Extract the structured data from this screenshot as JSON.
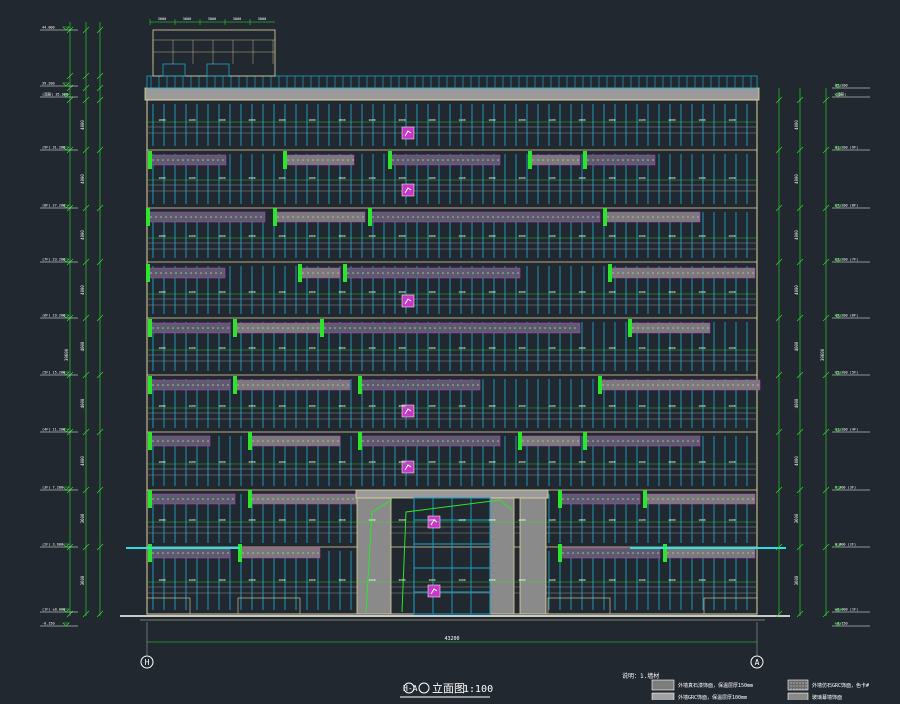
{
  "drawing": {
    "title_prefix": "H-A",
    "title_main": "立面图",
    "title_scale": "1:100",
    "grid_left": "H",
    "grid_right": "A",
    "overall_width": "43200",
    "overall_height_left": "39600",
    "overall_height_right": "39600",
    "notes_title": "说明：1.墙材",
    "legend": [
      "外墙真石漆饰面，保温层厚150mm",
      "外墙GRC饰面，保温层厚100mm",
      "外墙仿石GRC饰面，色卡#",
      "玻璃幕墙饰面"
    ],
    "colors": {
      "background": "#212830",
      "dimension": "#2ce62c",
      "mullion": "#1aa3c8",
      "parapet": "#9a9a9a",
      "outline": "#e3d6a0",
      "accent": "#c838c8",
      "glass": "#3a8cff"
    }
  },
  "elevations": {
    "left": [
      "44.000",
      "39.200",
      "(顶层) 35.200",
      "(9F) 31.200",
      "(8F) 27.200",
      "(7F) 23.200",
      "(6F) 19.200",
      "(5F) 15.200",
      "(4F) 11.200",
      "(3F) 7.200",
      "(2F) 3.600",
      "(1F) ±0.000",
      "-0.150"
    ],
    "right": [
      "35.200",
      "(顶层)",
      "31.200 (9F)",
      "27.200 (8F)",
      "23.200 (7F)",
      "19.200 (6F)",
      "15.200 (5F)",
      "11.200 (4F)",
      "7.200 (3F)",
      "3.600 (2F)",
      "±0.000 (1F)",
      "-0.150"
    ]
  },
  "dims": {
    "top_segments": [
      "3000",
      "3000",
      "3000",
      "3000",
      "3000"
    ],
    "row_segments": [
      "1800",
      "1600",
      "1800",
      "2000",
      "1600",
      "1800",
      "1800",
      "1600",
      "2000",
      "1800",
      "1600",
      "1800",
      "2000",
      "1600",
      "1800",
      "1800",
      "1600",
      "2000",
      "1800",
      "1600"
    ],
    "floor_heights": [
      "4000",
      "4000",
      "4000",
      "4000",
      "4000",
      "4000",
      "4000",
      "3600",
      "3600",
      "3600"
    ]
  }
}
